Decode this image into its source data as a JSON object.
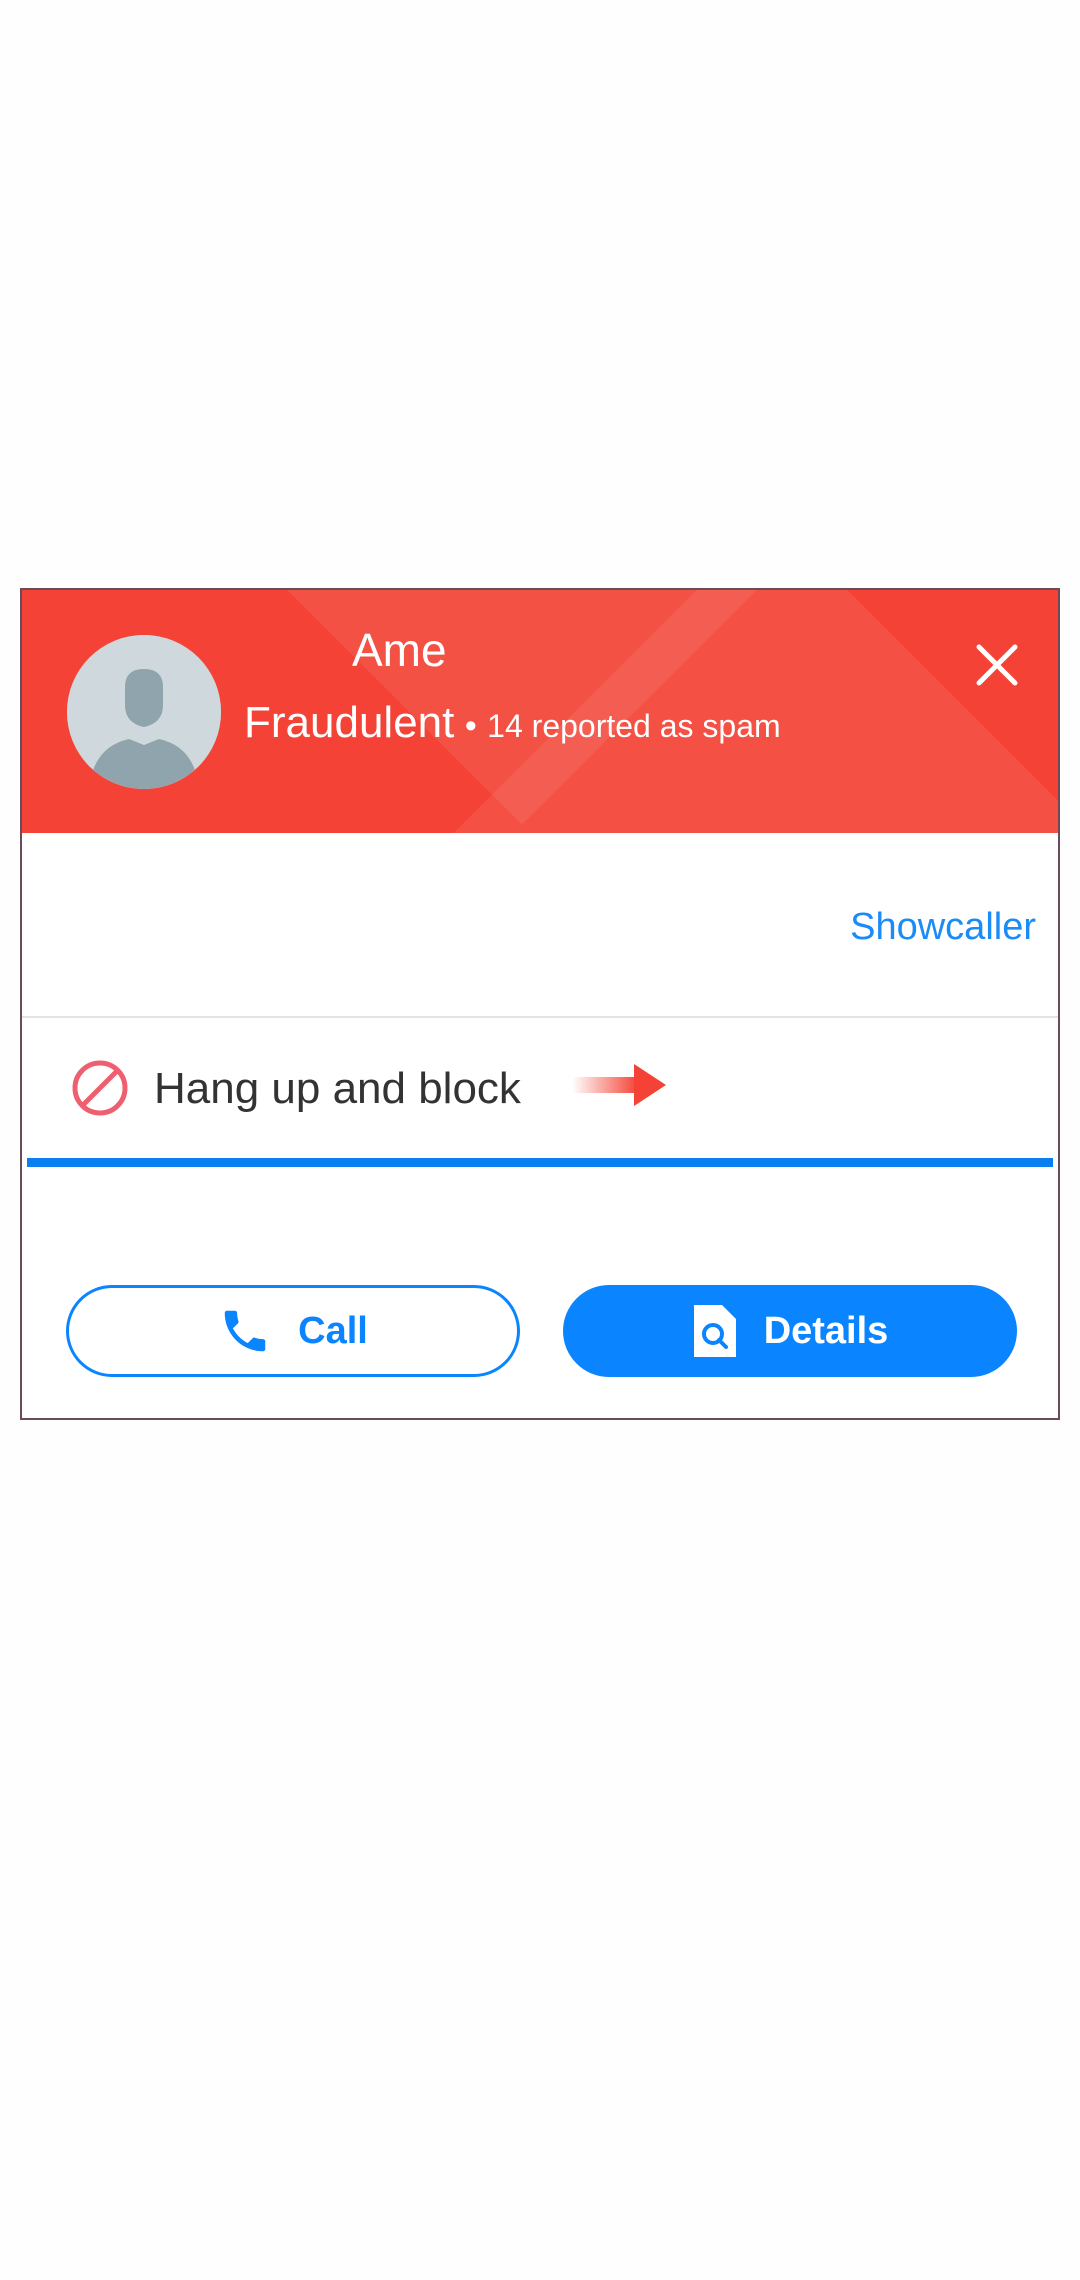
{
  "header": {
    "caller_name": "Ame",
    "status_label": "Fraudulent",
    "separator": "•",
    "spam_report": "14 reported as spam",
    "background_color": "#f44336"
  },
  "icons": {
    "avatar": "person-silhouette-icon",
    "close": "close-icon",
    "block": "block-icon",
    "arrow": "arrow-right-icon",
    "call": "phone-icon",
    "details": "document-search-icon"
  },
  "branding": {
    "showcaller_link": "Showcaller"
  },
  "block_action": {
    "label": "Hang up and block"
  },
  "actions": {
    "call_label": "Call",
    "details_label": "Details"
  },
  "colors": {
    "accent": "#0a84ff",
    "danger": "#f44336",
    "block_icon": "#ef5f6f"
  }
}
